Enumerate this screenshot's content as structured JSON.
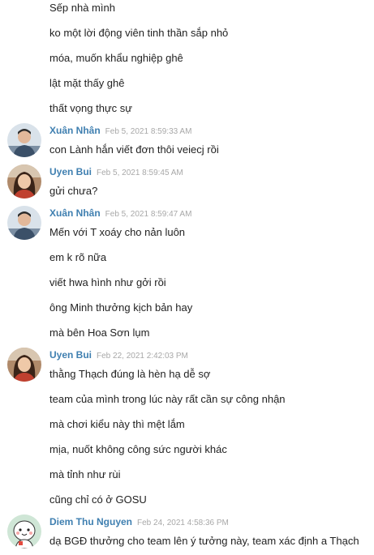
{
  "messages": [
    {
      "type": "line",
      "text": "Sếp nhà mình"
    },
    {
      "type": "line",
      "text": "ko một lời động viên tinh thần sắp nhỏ"
    },
    {
      "type": "line",
      "text": "móa, muốn khẩu nghiệp ghê"
    },
    {
      "type": "line",
      "text": "lật mặt thấy ghê"
    },
    {
      "type": "line",
      "text": "thất vọng thực sự"
    },
    {
      "type": "header",
      "author": "Xuân Nhân",
      "time": "Feb 5, 2021 8:59:33 AM",
      "avatar": "man-avatar"
    },
    {
      "type": "line",
      "text": "con Lành hắn viết đơn thôi veiecj rồi"
    },
    {
      "type": "header",
      "author": "Uyen Bui",
      "time": "Feb 5, 2021 8:59:45 AM",
      "avatar": "woman-avatar"
    },
    {
      "type": "line",
      "text": "gửi chưa?"
    },
    {
      "type": "header",
      "author": "Xuân Nhân",
      "time": "Feb 5, 2021 8:59:47 AM",
      "avatar": "man-avatar"
    },
    {
      "type": "line",
      "text": "Mến với T xoáy cho nản luôn"
    },
    {
      "type": "line",
      "text": "em k rõ nữa"
    },
    {
      "type": "line",
      "text": "viết hwa hình như gởi rồi"
    },
    {
      "type": "line",
      "text": "ông Minh thưởng kịch bản hay"
    },
    {
      "type": "line",
      "text": "mà bên Hoa Sơn lụm"
    },
    {
      "type": "header",
      "author": "Uyen Bui",
      "time": "Feb 22, 2021 2:42:03 PM",
      "avatar": "woman-avatar"
    },
    {
      "type": "line",
      "text": "thằng Thạch đúng là hèn hạ dễ sợ"
    },
    {
      "type": "line",
      "text": "team của mình trong lúc này rất cần sự công nhận"
    },
    {
      "type": "line",
      "text": "mà chơi kiểu này thì mệt lắm"
    },
    {
      "type": "line",
      "text": "mịa, nuốt không công sức người khác"
    },
    {
      "type": "line",
      "text": "mà tỉnh như rùi"
    },
    {
      "type": "line",
      "text": "cũng chỉ có ở GOSU"
    },
    {
      "type": "header",
      "author": "Diem Thu Nguyen",
      "time": "Feb 24, 2021 4:58:36 PM",
      "avatar": "cartoon-avatar"
    },
    {
      "type": "line",
      "text": "dạ BGĐ thưởng cho team lên ý tưởng này, team xác định a Thạch"
    }
  ]
}
